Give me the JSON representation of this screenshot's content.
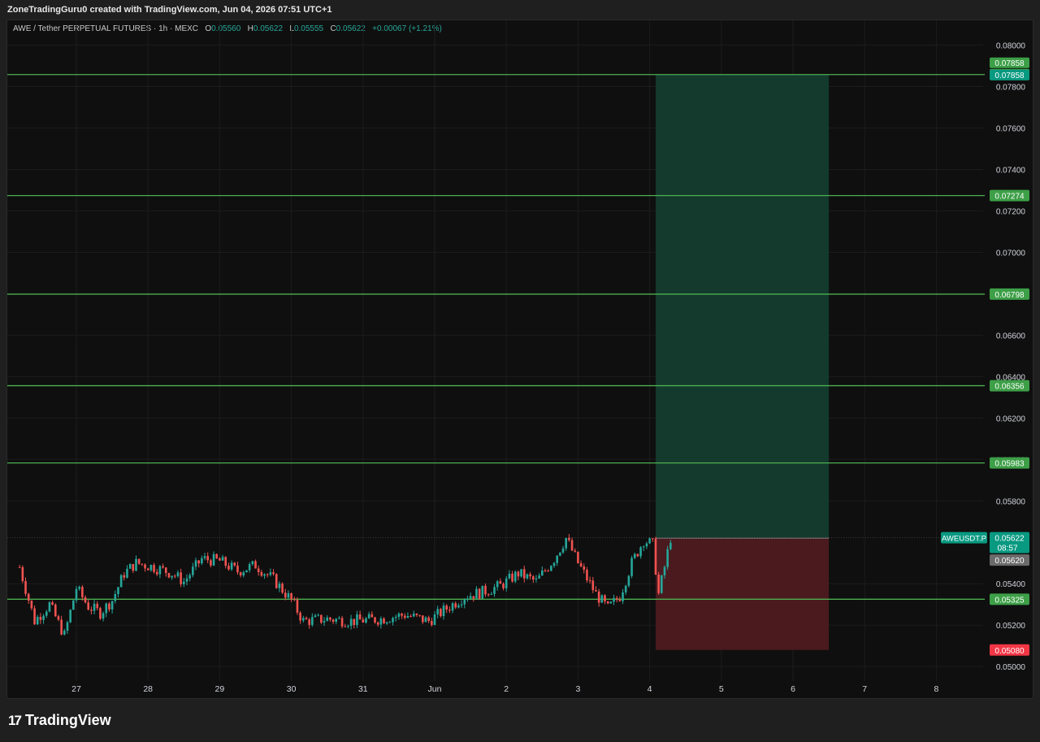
{
  "header": {
    "created_by": "ZoneTradingGuru0 created with TradingView.com, Jun 04, 2026 07:51 UTC+1"
  },
  "legend": {
    "symbol": "AWE / Tether PERPETUAL FUTURES · 1h · MEXC",
    "o_label": "O",
    "o": "0.05560",
    "h_label": "H",
    "h": "0.05622",
    "l_label": "L",
    "l": "0.05555",
    "c_label": "C",
    "c": "0.05622",
    "change": "+0.00067 (+1.21%)"
  },
  "footer": {
    "brand": "TradingView",
    "logo_icon": "tradingview-logo-icon"
  },
  "colors": {
    "bull": "#26a69a",
    "bear": "#ef5350",
    "level": "#4caf50",
    "profit_zone": "#133a2c",
    "loss_zone": "#4a1a1e",
    "grid": "#1c1c1c"
  },
  "chart_data": {
    "type": "candlestick",
    "symbol": "AWEUSDT.P",
    "interval": "1h",
    "ylim": [
      0.0493,
      0.0812
    ],
    "y_ticks": [
      "0.05000",
      "0.05200",
      "0.05400",
      "0.05800",
      "0.06000",
      "0.06200",
      "0.06400",
      "0.06600",
      "0.07000",
      "0.07200",
      "0.07400",
      "0.07600",
      "0.07800",
      "0.08000"
    ],
    "x_ticks": [
      {
        "label": "27",
        "x": "2026-05-27"
      },
      {
        "label": "28",
        "x": "2026-05-28"
      },
      {
        "label": "29",
        "x": "2026-05-29"
      },
      {
        "label": "30",
        "x": "2026-05-30"
      },
      {
        "label": "31",
        "x": "2026-05-31"
      },
      {
        "label": "Jun",
        "x": "2026-06-01"
      },
      {
        "label": "2",
        "x": "2026-06-02"
      },
      {
        "label": "3",
        "x": "2026-06-03"
      },
      {
        "label": "4",
        "x": "2026-06-04"
      },
      {
        "label": "5",
        "x": "2026-06-05"
      },
      {
        "label": "6",
        "x": "2026-06-06"
      },
      {
        "label": "7",
        "x": "2026-06-07"
      },
      {
        "label": "8",
        "x": "2026-06-08"
      }
    ],
    "horizontal_levels": [
      {
        "value": 0.07858,
        "label": "0.07858"
      },
      {
        "value": 0.07274,
        "label": "0.07274"
      },
      {
        "value": 0.06798,
        "label": "0.06798"
      },
      {
        "value": 0.06356,
        "label": "0.06356"
      },
      {
        "value": 0.05983,
        "label": "0.05983"
      },
      {
        "value": 0.05325,
        "label": "0.05325"
      }
    ],
    "position": {
      "type": "long",
      "entry": 0.0562,
      "target": 0.07858,
      "stop": 0.0508,
      "start": "2026-06-04 02:00",
      "end": "2026-06-06 12:00",
      "target_label": "0.07858",
      "entry_label": "0.05620",
      "stop_label": "0.05080"
    },
    "last_price": {
      "label": "AWEUSDT.P",
      "value": "0.05622",
      "countdown": "08:57"
    },
    "close_path": [
      {
        "t": "2026-05-26 05:00",
        "p": 0.0548
      },
      {
        "t": "2026-05-26 10:00",
        "p": 0.0522
      },
      {
        "t": "2026-05-26 15:00",
        "p": 0.053
      },
      {
        "t": "2026-05-26 20:00",
        "p": 0.0515
      },
      {
        "t": "2026-05-27 00:00",
        "p": 0.0538
      },
      {
        "t": "2026-05-27 04:00",
        "p": 0.0529
      },
      {
        "t": "2026-05-27 08:00",
        "p": 0.0526
      },
      {
        "t": "2026-05-27 12:00",
        "p": 0.0532
      },
      {
        "t": "2026-05-27 16:00",
        "p": 0.0545
      },
      {
        "t": "2026-05-27 20:00",
        "p": 0.055
      },
      {
        "t": "2026-05-28 02:00",
        "p": 0.0548
      },
      {
        "t": "2026-05-28 08:00",
        "p": 0.0545
      },
      {
        "t": "2026-05-28 12:00",
        "p": 0.0541
      },
      {
        "t": "2026-05-28 18:00",
        "p": 0.0552
      },
      {
        "t": "2026-05-29 00:00",
        "p": 0.0551
      },
      {
        "t": "2026-05-29 06:00",
        "p": 0.0546
      },
      {
        "t": "2026-05-29 12:00",
        "p": 0.0549
      },
      {
        "t": "2026-05-29 18:00",
        "p": 0.0542
      },
      {
        "t": "2026-05-30 00:00",
        "p": 0.0532
      },
      {
        "t": "2026-05-30 04:00",
        "p": 0.0522
      },
      {
        "t": "2026-05-30 12:00",
        "p": 0.0523
      },
      {
        "t": "2026-05-30 20:00",
        "p": 0.0522
      },
      {
        "t": "2026-05-31 06:00",
        "p": 0.0523
      },
      {
        "t": "2026-05-31 14:00",
        "p": 0.0525
      },
      {
        "t": "2026-05-31 22:00",
        "p": 0.0522
      },
      {
        "t": "2026-06-01 04:00",
        "p": 0.0528
      },
      {
        "t": "2026-06-01 10:00",
        "p": 0.0534
      },
      {
        "t": "2026-06-01 16:00",
        "p": 0.0536
      },
      {
        "t": "2026-06-01 22:00",
        "p": 0.0539
      },
      {
        "t": "2026-06-02 04:00",
        "p": 0.0545
      },
      {
        "t": "2026-06-02 10:00",
        "p": 0.0541
      },
      {
        "t": "2026-06-02 16:00",
        "p": 0.0552
      },
      {
        "t": "2026-06-02 20:00",
        "p": 0.0562
      },
      {
        "t": "2026-06-03 00:00",
        "p": 0.055
      },
      {
        "t": "2026-06-03 06:00",
        "p": 0.0535
      },
      {
        "t": "2026-06-03 10:00",
        "p": 0.0528
      },
      {
        "t": "2026-06-03 14:00",
        "p": 0.0534
      },
      {
        "t": "2026-06-03 18:00",
        "p": 0.055
      },
      {
        "t": "2026-06-03 22:00",
        "p": 0.0561
      },
      {
        "t": "2026-06-04 01:00",
        "p": 0.0559
      },
      {
        "t": "2026-06-04 03:00",
        "p": 0.0535
      },
      {
        "t": "2026-06-04 05:00",
        "p": 0.0548
      },
      {
        "t": "2026-06-04 07:00",
        "p": 0.05622
      }
    ]
  }
}
